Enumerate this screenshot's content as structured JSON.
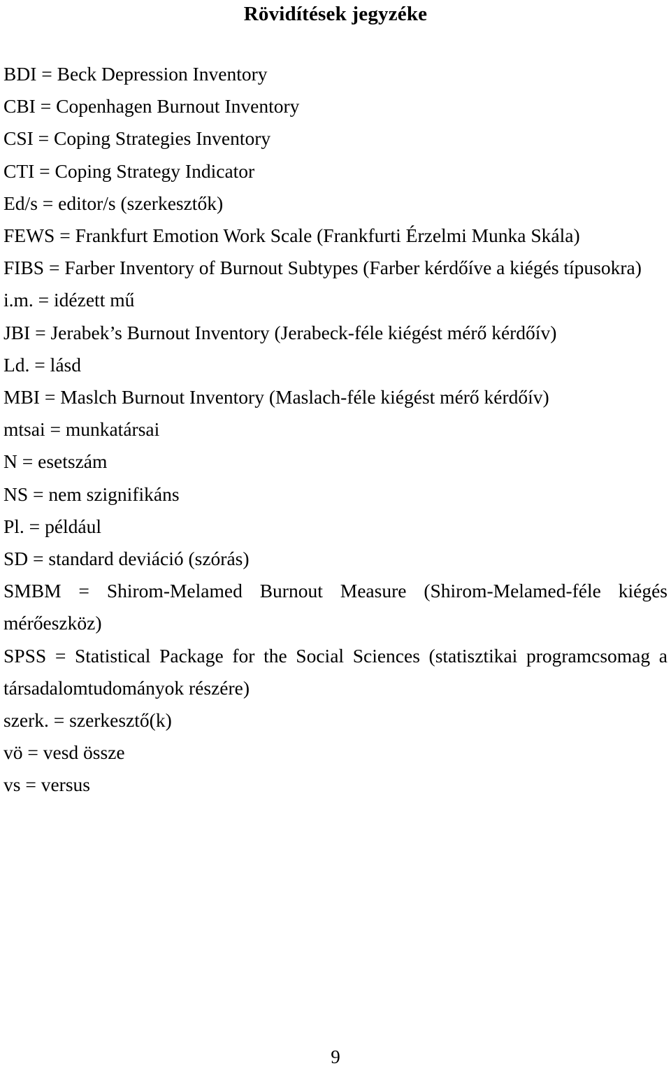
{
  "document": {
    "title": "Rövidítések jegyzéke",
    "page_number": "9",
    "entries": [
      {
        "text": "BDI = Beck Depression Inventory",
        "wrapped": false
      },
      {
        "text": "CBI = Copenhagen Burnout Inventory",
        "wrapped": false
      },
      {
        "text": "CSI = Coping Strategies Inventory",
        "wrapped": false
      },
      {
        "text": "CTI = Coping Strategy Indicator",
        "wrapped": false
      },
      {
        "text": "Ed/s = editor/s (szerkesztők)",
        "wrapped": false
      },
      {
        "text": "FEWS = Frankfurt Emotion Work Scale (Frankfurti Érzelmi Munka Skála)",
        "wrapped": false
      },
      {
        "text": "FIBS = Farber Inventory of Burnout Subtypes (Farber kérdőíve a kiégés típusokra)",
        "wrapped": false
      },
      {
        "text": "i.m. = idézett mű",
        "wrapped": false
      },
      {
        "text": "JBI = Jerabek’s Burnout Inventory (Jerabeck-féle kiégést mérő kérdőív)",
        "wrapped": false
      },
      {
        "text": "Ld. = lásd",
        "wrapped": false
      },
      {
        "text": "MBI = Maslch Burnout Inventory (Maslach-féle kiégést mérő kérdőív)",
        "wrapped": false
      },
      {
        "text": "mtsai = munkatársai",
        "wrapped": false
      },
      {
        "text": "N = esetszám",
        "wrapped": false
      },
      {
        "text": "NS = nem szignifikáns",
        "wrapped": false
      },
      {
        "text": "Pl. = például",
        "wrapped": false
      },
      {
        "text": "SD = standard deviáció (szórás)",
        "wrapped": false
      },
      {
        "text": "SMBM = Shirom-Melamed Burnout Measure (Shirom-Melamed-féle kiégés mérőeszköz)",
        "wrapped": true
      },
      {
        "text": "SPSS = Statistical Package for the Social Sciences (statisztikai programcsomag a társadalomtudományok részére)",
        "wrapped": true
      },
      {
        "text": "szerk. = szerkesztő(k)",
        "wrapped": false
      },
      {
        "text": "vö = vesd össze",
        "wrapped": false
      },
      {
        "text": "vs = versus",
        "wrapped": false
      }
    ]
  }
}
